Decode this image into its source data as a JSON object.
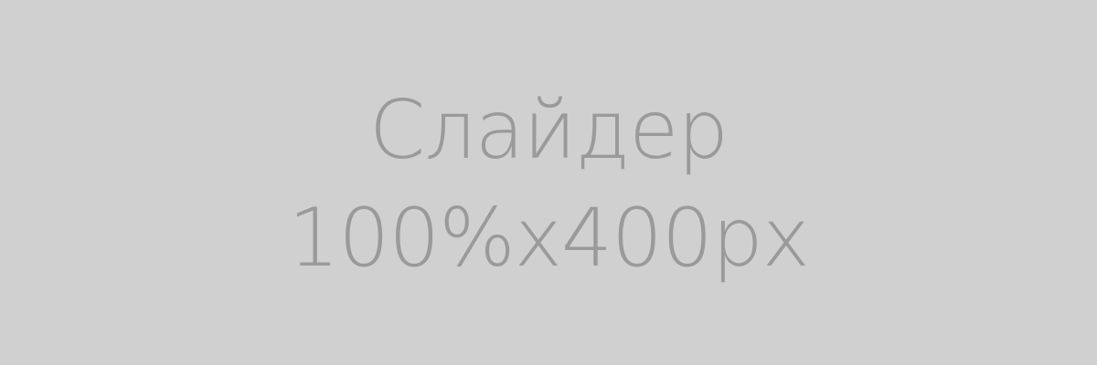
{
  "slider": {
    "title": "Слайдер",
    "dimensions": "100%x400px"
  },
  "colors": {
    "background": "#d0d0d0",
    "text": "#9a9a9a"
  }
}
